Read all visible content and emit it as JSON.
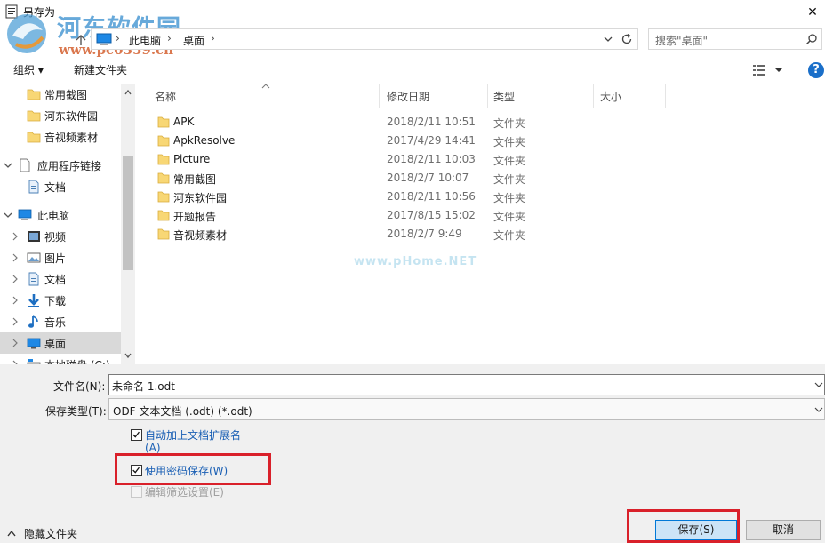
{
  "window": {
    "title": "另存为",
    "close_glyph": "✕"
  },
  "watermark": {
    "site_name": "河东软件园",
    "site_url": "www.pc0359.cn",
    "center_mark": "www.pHome.NET"
  },
  "address": {
    "segments": [
      "此电脑",
      "桌面"
    ],
    "separator": "›",
    "search_placeholder": "搜索\"桌面\""
  },
  "toolbar": {
    "organize_label": "组织 ▾",
    "new_folder_label": "新建文件夹",
    "help_label": "?"
  },
  "nav": {
    "items": [
      {
        "label": "常用截图",
        "icon": "folder-icon",
        "level": 2
      },
      {
        "label": "河东软件园",
        "icon": "folder-icon",
        "level": 2
      },
      {
        "label": "音视频素材",
        "icon": "folder-icon",
        "level": 2
      },
      {
        "label": "应用程序链接",
        "icon": "document-icon",
        "level": 1,
        "expanded": true
      },
      {
        "label": "文档",
        "icon": "document-icon",
        "level": 2
      },
      {
        "label": "此电脑",
        "icon": "computer-icon",
        "level": 1,
        "expanded": true
      },
      {
        "label": "视频",
        "icon": "video-icon",
        "level": 2
      },
      {
        "label": "图片",
        "icon": "pictures-icon",
        "level": 2
      },
      {
        "label": "文档",
        "icon": "document-icon",
        "level": 2
      },
      {
        "label": "下载",
        "icon": "download-icon",
        "level": 2
      },
      {
        "label": "音乐",
        "icon": "music-icon",
        "level": 2
      },
      {
        "label": "桌面",
        "icon": "desktop-icon",
        "level": 2,
        "selected": true
      },
      {
        "label": "本地磁盘 (C:)",
        "icon": "drive-icon",
        "level": 2
      }
    ]
  },
  "filelist": {
    "columns": [
      "名称",
      "修改日期",
      "类型",
      "大小"
    ],
    "rows": [
      {
        "name": "APK",
        "date": "2018/2/11 10:51",
        "type": "文件夹"
      },
      {
        "name": "ApkResolve",
        "date": "2017/4/29 14:41",
        "type": "文件夹"
      },
      {
        "name": "Picture",
        "date": "2018/2/11 10:03",
        "type": "文件夹"
      },
      {
        "name": "常用截图",
        "date": "2018/2/7 10:07",
        "type": "文件夹"
      },
      {
        "name": "河东软件园",
        "date": "2018/2/11 10:56",
        "type": "文件夹"
      },
      {
        "name": "开题报告",
        "date": "2017/8/15 15:02",
        "type": "文件夹"
      },
      {
        "name": "音视频素材",
        "date": "2018/2/7 9:49",
        "type": "文件夹"
      }
    ]
  },
  "form": {
    "filename_label": "文件名(N):",
    "filename_value": "未命名 1.odt",
    "filetype_label": "保存类型(T):",
    "filetype_value": "ODF 文本文档 (.odt) (*.odt)",
    "options": [
      {
        "label": "自动加上文档扩展名",
        "label2": "(A)",
        "checked": true,
        "enabled": true
      },
      {
        "label": "使用密码保存(W)",
        "checked": true,
        "enabled": true
      },
      {
        "label": "编辑筛选设置(E)",
        "checked": false,
        "enabled": false
      }
    ],
    "hide_folders_label": "隐藏文件夹",
    "save_label": "保存(S)",
    "cancel_label": "取消"
  },
  "colors": {
    "accent": "#0078d7",
    "highlight_box": "#d9202a",
    "folder_yellow": "#f8d775",
    "link_blue": "#1a5fb4"
  }
}
